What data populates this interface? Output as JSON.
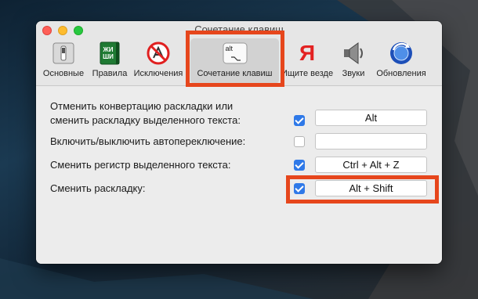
{
  "window": {
    "title": "Сочетание клавиш"
  },
  "toolbar": {
    "items": [
      {
        "label": "Основные",
        "icon": "switch-icon"
      },
      {
        "label": "Правила",
        "icon": "green-book-icon",
        "icon_text": "ЖИ ШИ"
      },
      {
        "label": "Исключения",
        "icon": "no-apps-icon"
      },
      {
        "label": "Сочетание клавиш",
        "icon": "alt-key-icon",
        "icon_text": "alt",
        "selected": true
      },
      {
        "label": "Ищите везде",
        "icon": "yandex-icon",
        "icon_text": "Я"
      },
      {
        "label": "Звуки",
        "icon": "speaker-icon"
      },
      {
        "label": "Обновления",
        "icon": "update-globe-icon"
      }
    ]
  },
  "settings": {
    "rows": [
      {
        "label": "Отменить конвертацию раскладки или\nсменить раскладку выделенного текста:",
        "checked": true,
        "shortcut": "Alt"
      },
      {
        "label": "Включить/выключить автопереключение:",
        "checked": false,
        "shortcut": ""
      },
      {
        "label": "Сменить регистр выделенного текста:",
        "checked": true,
        "shortcut": "Ctrl + Alt + Z"
      },
      {
        "label": "Сменить раскладку:",
        "checked": true,
        "shortcut": "Alt + Shift"
      }
    ]
  },
  "colors": {
    "highlight": "#e6461c",
    "checkbox_accent": "#2f79e8"
  }
}
